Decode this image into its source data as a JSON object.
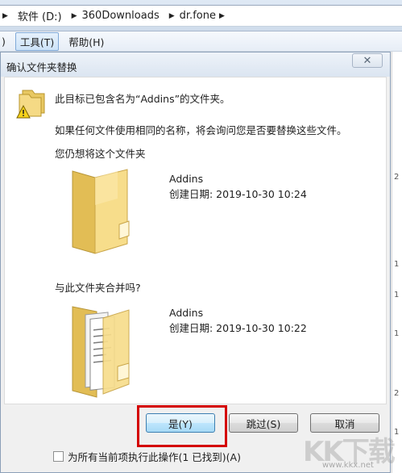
{
  "breadcrumb": {
    "items": [
      "软件 (D:)",
      "360Downloads",
      "dr.fone"
    ]
  },
  "menubar": {
    "items": [
      {
        "label": ")"
      },
      {
        "label": "工具(T)"
      },
      {
        "label": "帮助(H)"
      }
    ]
  },
  "edge": {
    "digits": [
      "2",
      "1",
      "1",
      "1",
      "2",
      "1"
    ]
  },
  "dialog": {
    "title": "确认文件夹替换",
    "close_label": "✕",
    "message": "此目标已包含名为“Addins”的文件夹。",
    "explain": "如果任何文件使用相同的名称，将会询问您是否要替换这些文件。",
    "prompt_keep": "您仍想将这个文件夹",
    "prompt_merge": "与此文件夹合并吗?",
    "source": {
      "name": "Addins",
      "created": "创建日期: 2019-10-30 10:24"
    },
    "target": {
      "name": "Addins",
      "created": "创建日期: 2019-10-30 10:22"
    },
    "buttons": {
      "yes": "是(Y)",
      "skip": "跳过(S)",
      "cancel": "取消"
    },
    "checkbox_label": "为所有当前项执行此操作(1 已找到)(A)"
  },
  "watermark": {
    "text": "KK下载",
    "url": "www.kkx.net"
  },
  "colors": {
    "highlight": "#d40000",
    "folder": "#f3d27a"
  }
}
